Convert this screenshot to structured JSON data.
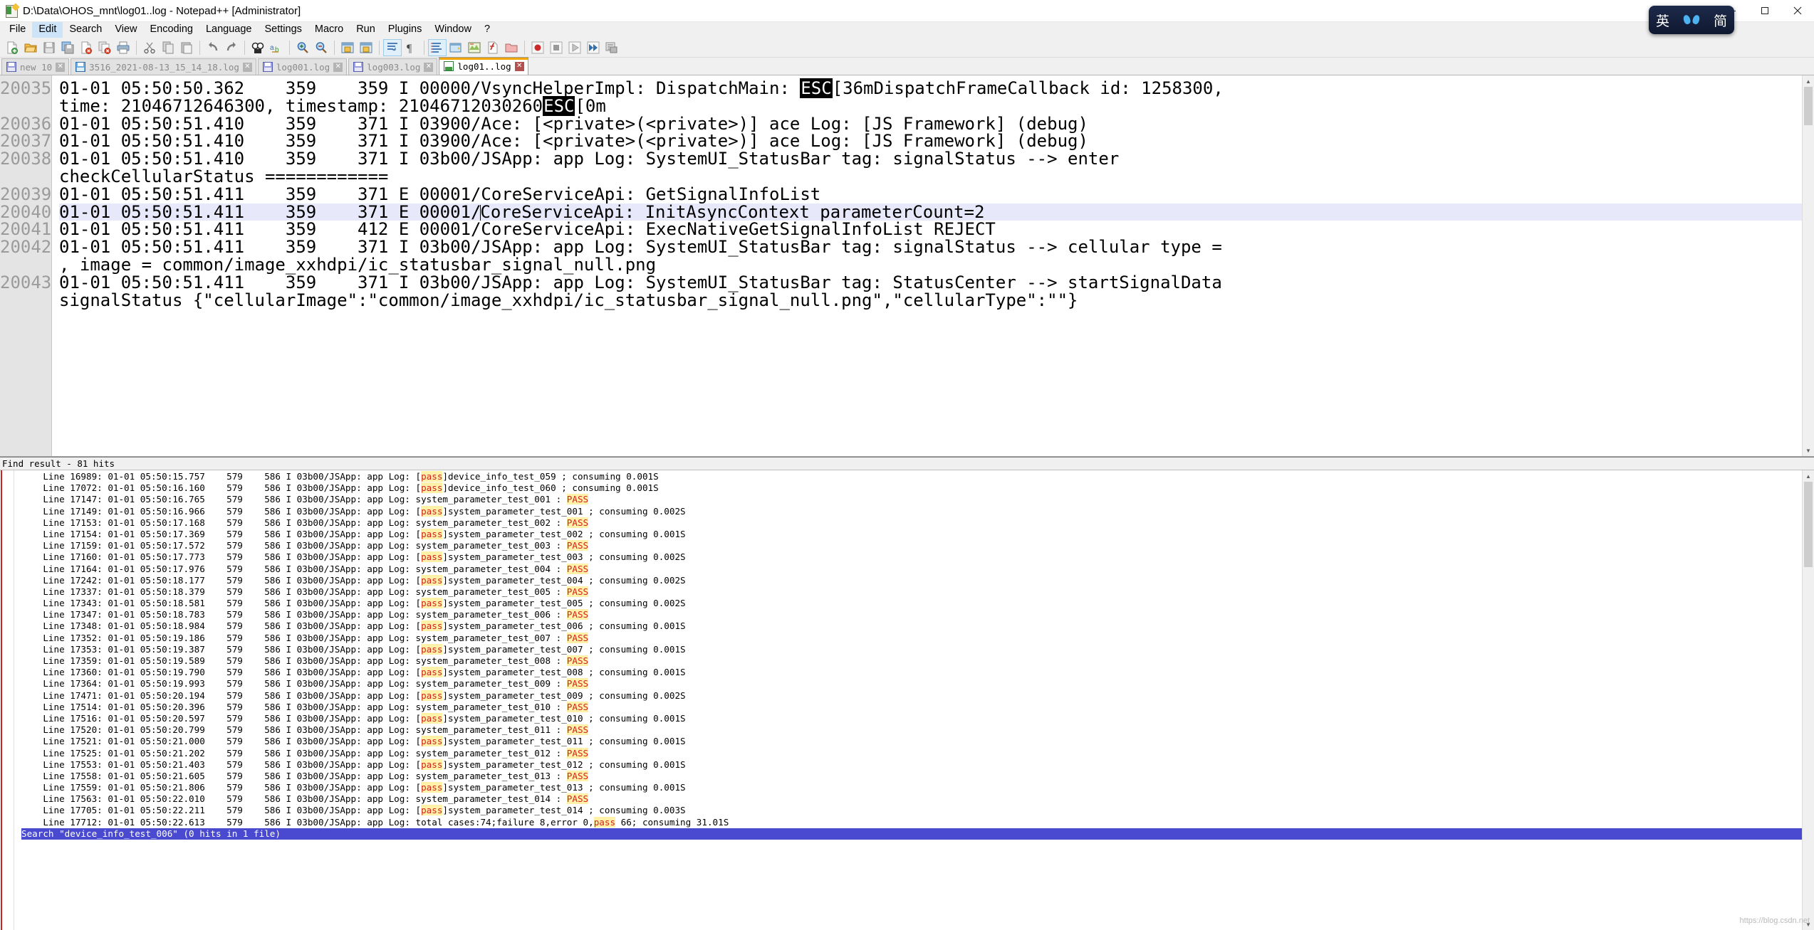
{
  "window": {
    "title": "D:\\Data\\OHOS_mnt\\log01..log - Notepad++ [Administrator]",
    "icon": "notepadpp-icon",
    "minimize": "minimize-button",
    "maximize": "maximize-button",
    "close": "close-button"
  },
  "menu": {
    "items": [
      {
        "label": "File",
        "highlight": false
      },
      {
        "label": "Edit",
        "highlight": true
      },
      {
        "label": "Search",
        "highlight": false
      },
      {
        "label": "View",
        "highlight": false
      },
      {
        "label": "Encoding",
        "highlight": false
      },
      {
        "label": "Language",
        "highlight": false
      },
      {
        "label": "Settings",
        "highlight": false
      },
      {
        "label": "Macro",
        "highlight": false
      },
      {
        "label": "Run",
        "highlight": false
      },
      {
        "label": "Plugins",
        "highlight": false
      },
      {
        "label": "Window",
        "highlight": false
      },
      {
        "label": "?",
        "highlight": false
      }
    ]
  },
  "toolbar": {
    "buttons": [
      "new-file-icon",
      "open-file-icon",
      "save-icon",
      "save-all-icon",
      "close-file-icon",
      "close-all-icon",
      "print-icon",
      "sep",
      "cut-icon",
      "copy-icon",
      "paste-icon",
      "sep",
      "undo-icon",
      "redo-icon",
      "sep",
      "find-icon",
      "replace-icon",
      "sep",
      "zoom-in-icon",
      "zoom-out-icon",
      "sep",
      "sync-vertical-icon",
      "sync-horizontal-icon",
      "sep",
      "word-wrap-icon",
      "show-all-chars-icon",
      "sep",
      "indent-guide-icon",
      "user-defined-dialog-icon",
      "document-map-icon",
      "function-list-icon",
      "folder-as-workspace-icon",
      "sep",
      "record-macro-icon",
      "stop-macro-icon",
      "play-macro-icon",
      "fast-playback-icon",
      "save-macro-icon"
    ]
  },
  "tabs": [
    {
      "label": "new 10",
      "icon": "save-purple-icon",
      "active": false,
      "close": "✕"
    },
    {
      "label": "3516_2021-08-13_15_14_18.log",
      "icon": "save-blue-icon",
      "active": false,
      "close": "✕"
    },
    {
      "label": "log001.log",
      "icon": "save-purple-icon",
      "active": false,
      "close": "✕"
    },
    {
      "label": "log003.log",
      "icon": "save-purple-icon",
      "active": false,
      "close": "✕"
    },
    {
      "label": "log01..log",
      "icon": "save-green-icon",
      "active": true,
      "close": "✕"
    }
  ],
  "editor": {
    "line_numbers": [
      "20035",
      "",
      "20036",
      "20037",
      "20038",
      "",
      "20039",
      "20040",
      "20041",
      "20042",
      "",
      "20043",
      ""
    ],
    "lines": [
      {
        "num": "20035",
        "selected": false,
        "parts": [
          {
            "t": "01-01 05:50:50.362    359    359 I 00000/VsyncHelperImpl: DispatchMain: ",
            "k": "plain"
          },
          {
            "t": "ESC",
            "k": "esc"
          },
          {
            "t": "[36mDispatchFrameCallback id: 1258300,",
            "k": "plain"
          }
        ]
      },
      {
        "num": "",
        "selected": false,
        "parts": [
          {
            "t": "time: 21046712646300, timestamp: 21046712030260",
            "k": "plain"
          },
          {
            "t": "ESC",
            "k": "esc"
          },
          {
            "t": "[0m",
            "k": "plain"
          }
        ]
      },
      {
        "num": "20036",
        "selected": false,
        "parts": [
          {
            "t": "01-01 05:50:51.410    359    371 I 03900/Ace: [<private>(<private>)] ace Log: [JS Framework] (debug)",
            "k": "plain"
          }
        ]
      },
      {
        "num": "20037",
        "selected": false,
        "parts": [
          {
            "t": "01-01 05:50:51.410    359    371 I 03900/Ace: [<private>(<private>)] ace Log: [JS Framework] (debug)",
            "k": "plain"
          }
        ]
      },
      {
        "num": "20038",
        "selected": false,
        "parts": [
          {
            "t": "01-01 05:50:51.410    359    371 I 03b00/JSApp: app Log: SystemUI_StatusBar tag: signalStatus --> enter",
            "k": "plain"
          }
        ]
      },
      {
        "num": "",
        "selected": false,
        "parts": [
          {
            "t": "checkCellularStatus ============",
            "k": "plain"
          }
        ]
      },
      {
        "num": "20039",
        "selected": false,
        "parts": [
          {
            "t": "01-01 05:50:51.411    359    371 E 00001/CoreServiceApi: GetSignalInfoList",
            "k": "plain"
          }
        ]
      },
      {
        "num": "20040",
        "selected": true,
        "parts": [
          {
            "t": "01-01 05:50:51.411    359    371 E 00001/",
            "k": "plain"
          },
          {
            "t": "|",
            "k": "caret"
          },
          {
            "t": "CoreServiceApi: InitAsyncContext parameterCount=2",
            "k": "plain"
          }
        ]
      },
      {
        "num": "20041",
        "selected": false,
        "parts": [
          {
            "t": "01-01 05:50:51.411    359    412 E 00001/CoreServiceApi: ExecNativeGetSignalInfoList REJECT",
            "k": "plain"
          }
        ]
      },
      {
        "num": "20042",
        "selected": false,
        "parts": [
          {
            "t": "01-01 05:50:51.411    359    371 I 03b00/JSApp: app Log: SystemUI_StatusBar tag: signalStatus --> cellular type =",
            "k": "plain"
          }
        ]
      },
      {
        "num": "",
        "selected": false,
        "parts": [
          {
            "t": ", image = common/image_xxhdpi/ic_statusbar_signal_null.png",
            "k": "plain"
          }
        ]
      },
      {
        "num": "20043",
        "selected": false,
        "parts": [
          {
            "t": "01-01 05:50:51.411    359    371 I 03b00/JSApp: app Log: SystemUI_StatusBar tag: StatusCenter --> startSignalData",
            "k": "plain"
          }
        ]
      },
      {
        "num": "",
        "selected": false,
        "parts": [
          {
            "t": "signalStatus {\"cellularImage\":\"common/image_xxhdpi/ic_statusbar_signal_null.png\",\"cellularType\":\"\"}",
            "k": "plain"
          }
        ]
      }
    ]
  },
  "find_panel": {
    "header": "Find result - 81 hits",
    "rows": [
      {
        "pre": "    Line 16989: 01-01 05:50:15.757    579    586 I 03b00/JSApp: app Log: [",
        "hit": "pass",
        "post": "]device_info_test_059 ; consuming 0.001S"
      },
      {
        "pre": "    Line 17072: 01-01 05:50:16.160    579    586 I 03b00/JSApp: app Log: [",
        "hit": "pass",
        "post": "]device_info_test_060 ; consuming 0.001S"
      },
      {
        "pre": "    Line 17147: 01-01 05:50:16.765    579    586 I 03b00/JSApp: app Log: system_parameter_test_001 : ",
        "hit": "PASS",
        "post": ""
      },
      {
        "pre": "    Line 17149: 01-01 05:50:16.966    579    586 I 03b00/JSApp: app Log: [",
        "hit": "pass",
        "post": "]system_parameter_test_001 ; consuming 0.002S"
      },
      {
        "pre": "    Line 17153: 01-01 05:50:17.168    579    586 I 03b00/JSApp: app Log: system_parameter_test_002 : ",
        "hit": "PASS",
        "post": ""
      },
      {
        "pre": "    Line 17154: 01-01 05:50:17.369    579    586 I 03b00/JSApp: app Log: [",
        "hit": "pass",
        "post": "]system_parameter_test_002 ; consuming 0.001S"
      },
      {
        "pre": "    Line 17159: 01-01 05:50:17.572    579    586 I 03b00/JSApp: app Log: system_parameter_test_003 : ",
        "hit": "PASS",
        "post": ""
      },
      {
        "pre": "    Line 17160: 01-01 05:50:17.773    579    586 I 03b00/JSApp: app Log: [",
        "hit": "pass",
        "post": "]system_parameter_test_003 ; consuming 0.002S"
      },
      {
        "pre": "    Line 17164: 01-01 05:50:17.976    579    586 I 03b00/JSApp: app Log: system_parameter_test_004 : ",
        "hit": "PASS",
        "post": ""
      },
      {
        "pre": "    Line 17242: 01-01 05:50:18.177    579    586 I 03b00/JSApp: app Log: [",
        "hit": "pass",
        "post": "]system_parameter_test_004 ; consuming 0.002S"
      },
      {
        "pre": "    Line 17337: 01-01 05:50:18.379    579    586 I 03b00/JSApp: app Log: system_parameter_test_005 : ",
        "hit": "PASS",
        "post": ""
      },
      {
        "pre": "    Line 17343: 01-01 05:50:18.581    579    586 I 03b00/JSApp: app Log: [",
        "hit": "pass",
        "post": "]system_parameter_test_005 ; consuming 0.002S"
      },
      {
        "pre": "    Line 17347: 01-01 05:50:18.783    579    586 I 03b00/JSApp: app Log: system_parameter_test_006 : ",
        "hit": "PASS",
        "post": ""
      },
      {
        "pre": "    Line 17348: 01-01 05:50:18.984    579    586 I 03b00/JSApp: app Log: [",
        "hit": "pass",
        "post": "]system_parameter_test_006 ; consuming 0.001S"
      },
      {
        "pre": "    Line 17352: 01-01 05:50:19.186    579    586 I 03b00/JSApp: app Log: system_parameter_test_007 : ",
        "hit": "PASS",
        "post": ""
      },
      {
        "pre": "    Line 17353: 01-01 05:50:19.387    579    586 I 03b00/JSApp: app Log: [",
        "hit": "pass",
        "post": "]system_parameter_test_007 ; consuming 0.001S"
      },
      {
        "pre": "    Line 17359: 01-01 05:50:19.589    579    586 I 03b00/JSApp: app Log: system_parameter_test_008 : ",
        "hit": "PASS",
        "post": ""
      },
      {
        "pre": "    Line 17360: 01-01 05:50:19.790    579    586 I 03b00/JSApp: app Log: [",
        "hit": "pass",
        "post": "]system_parameter_test_008 ; consuming 0.001S"
      },
      {
        "pre": "    Line 17364: 01-01 05:50:19.993    579    586 I 03b00/JSApp: app Log: system_parameter_test_009 : ",
        "hit": "PASS",
        "post": ""
      },
      {
        "pre": "    Line 17471: 01-01 05:50:20.194    579    586 I 03b00/JSApp: app Log: [",
        "hit": "pass",
        "post": "]system_parameter_test_009 ; consuming 0.002S"
      },
      {
        "pre": "    Line 17514: 01-01 05:50:20.396    579    586 I 03b00/JSApp: app Log: system_parameter_test_010 : ",
        "hit": "PASS",
        "post": ""
      },
      {
        "pre": "    Line 17516: 01-01 05:50:20.597    579    586 I 03b00/JSApp: app Log: [",
        "hit": "pass",
        "post": "]system_parameter_test_010 ; consuming 0.001S"
      },
      {
        "pre": "    Line 17520: 01-01 05:50:20.799    579    586 I 03b00/JSApp: app Log: system_parameter_test_011 : ",
        "hit": "PASS",
        "post": ""
      },
      {
        "pre": "    Line 17521: 01-01 05:50:21.000    579    586 I 03b00/JSApp: app Log: [",
        "hit": "pass",
        "post": "]system_parameter_test_011 ; consuming 0.001S"
      },
      {
        "pre": "    Line 17525: 01-01 05:50:21.202    579    586 I 03b00/JSApp: app Log: system_parameter_test_012 : ",
        "hit": "PASS",
        "post": ""
      },
      {
        "pre": "    Line 17553: 01-01 05:50:21.403    579    586 I 03b00/JSApp: app Log: [",
        "hit": "pass",
        "post": "]system_parameter_test_012 ; consuming 0.001S"
      },
      {
        "pre": "    Line 17558: 01-01 05:50:21.605    579    586 I 03b00/JSApp: app Log: system_parameter_test_013 : ",
        "hit": "PASS",
        "post": ""
      },
      {
        "pre": "    Line 17559: 01-01 05:50:21.806    579    586 I 03b00/JSApp: app Log: [",
        "hit": "pass",
        "post": "]system_parameter_test_013 ; consuming 0.001S"
      },
      {
        "pre": "    Line 17563: 01-01 05:50:22.010    579    586 I 03b00/JSApp: app Log: system_parameter_test_014 : ",
        "hit": "PASS",
        "post": ""
      },
      {
        "pre": "    Line 17705: 01-01 05:50:22.211    579    586 I 03b00/JSApp: app Log: [",
        "hit": "pass",
        "post": "]system_parameter_test_014 ; consuming 0.003S"
      },
      {
        "pre": "    Line 17712: 01-01 05:50:22.613    579    586 I 03b00/JSApp: app Log: total cases:74;failure 8,error 0,",
        "hit": "pass",
        "post": " 66; consuming 31.01S"
      }
    ],
    "footer": "Search \"device_info_test_006\" (0 hits in 1 file)"
  },
  "ime": {
    "mode_label": "英",
    "shape_label": "简",
    "icon": "ime-butterfly-icon"
  },
  "watermark": "https://blog.csdn.net"
}
